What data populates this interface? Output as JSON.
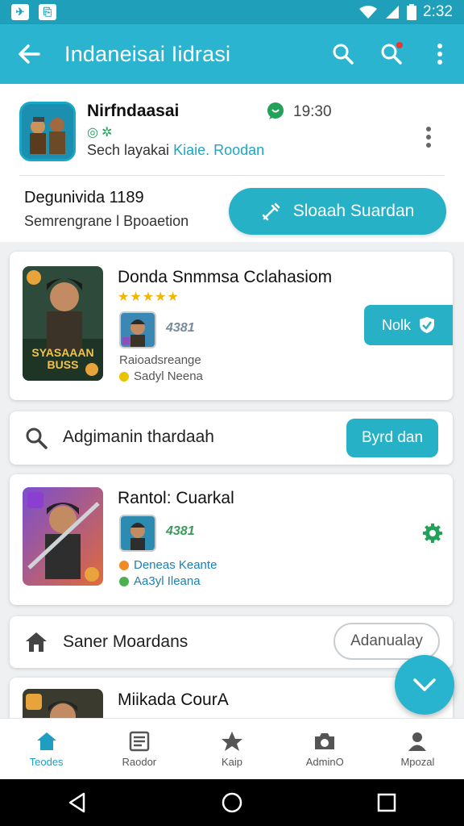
{
  "status_bar": {
    "time": "2:32"
  },
  "app_bar": {
    "title": "Indaneisai Iidrasi"
  },
  "header": {
    "app_name": "Nirfndaasai",
    "time": "19:30",
    "desc_prefix": "Sech layakai",
    "desc_link": "Kiaie. Roodan",
    "stat_title": "Degunivida 1189",
    "stat_sub": "Semrengrane l Bpoaetion",
    "primary_button": "Sloaah Suardan"
  },
  "card1": {
    "title": "Donda Snmmsa Cclahasiom",
    "rating": 4.5,
    "stat": "4381",
    "meta1": "Raioadsreange",
    "meta2": "Sadyl Neena",
    "tab_button": "Nolk",
    "thumb_text": "SYASAAAN BUSS"
  },
  "row1": {
    "title": "Adgimanin thardaah",
    "button": "Byrd dan"
  },
  "card2": {
    "title": "Rantol: Cuarkal",
    "stat": "4381",
    "meta1": "Deneas Keante",
    "meta2": "Aa3yl Ileana"
  },
  "row2": {
    "title": "Saner Moardans",
    "button": "Adanualay"
  },
  "card3": {
    "title": "Miikada CourA"
  },
  "bottom_nav": [
    {
      "label": "Teodes",
      "icon": "home-icon"
    },
    {
      "label": "Raodor",
      "icon": "news-icon"
    },
    {
      "label": "Kaip",
      "icon": "pin-icon"
    },
    {
      "label": "AdminO",
      "icon": "camera-icon"
    },
    {
      "label": "Mpozal",
      "icon": "person-icon"
    }
  ],
  "colors": {
    "accent": "#2ab4cf",
    "accent_dark": "#1f9fb9",
    "star": "#f4b400",
    "green": "#23a05a"
  }
}
